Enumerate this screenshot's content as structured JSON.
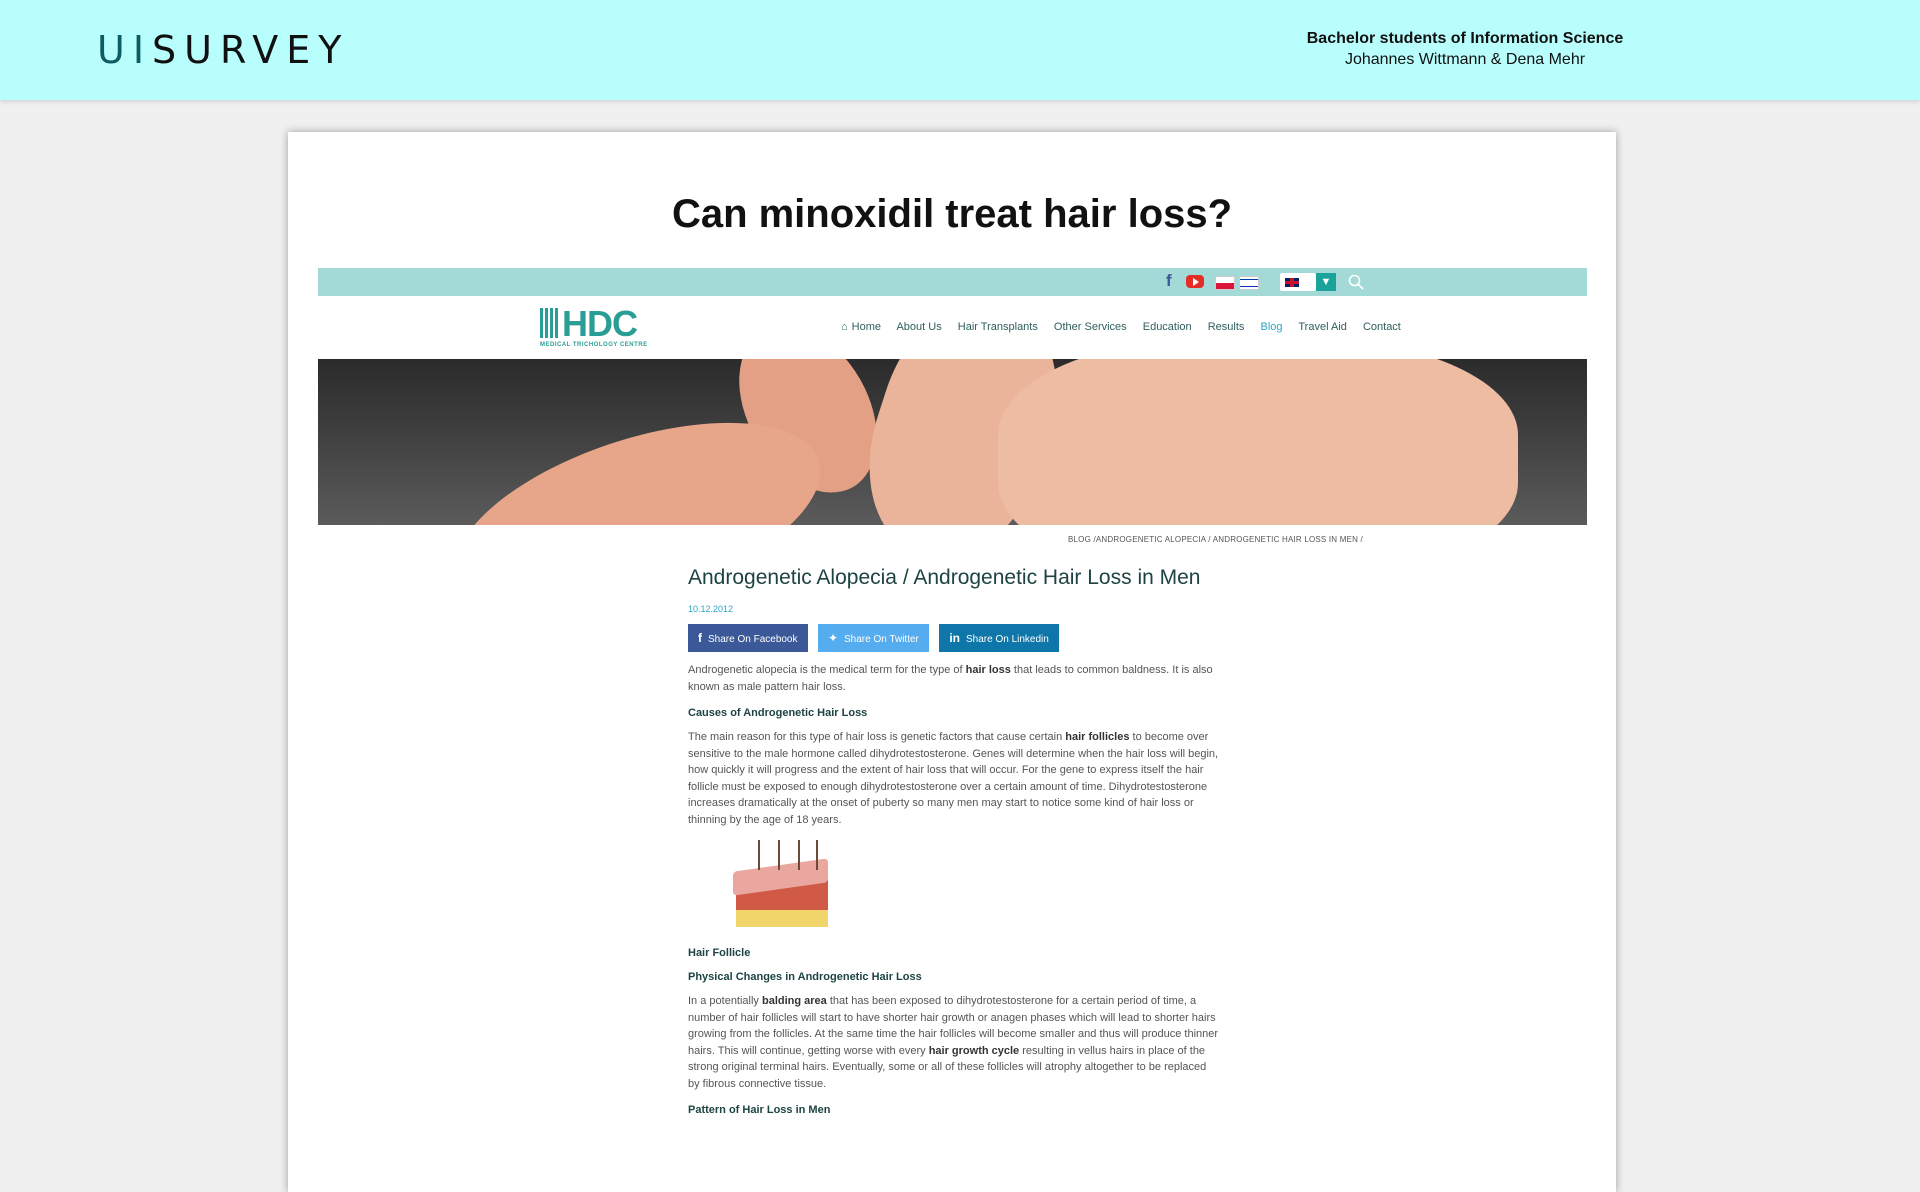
{
  "header": {
    "logo_ui": "UI",
    "logo_survey": "SURVEY",
    "credit_line1": "Bachelor students of Information Science",
    "credit_line2": "Johannes Wittmann & Dena Mehr"
  },
  "question": "Can minoxidil treat hair loss?",
  "site": {
    "brand": "HDC",
    "brand_sub": "MEDICAL TRICHOLOGY CENTRE",
    "menu": [
      "Home",
      "About Us",
      "Hair Transplants",
      "Other Services",
      "Education",
      "Results",
      "Blog",
      "Travel Aid",
      "Contact"
    ],
    "active_menu": "Blog",
    "breadcrumb": "BLOG /ANDROGENETIC ALOPECIA / ANDROGENETIC HAIR LOSS IN MEN /"
  },
  "article": {
    "title": "Androgenetic Alopecia / Androgenetic Hair Loss in Men",
    "date": "10.12.2012",
    "share_facebook": "Share On Facebook",
    "share_twitter": "Share On Twitter",
    "share_linkedin": "Share On Linkedin",
    "intro_a": "Androgenetic alopecia is the medical term for the type of ",
    "intro_b": "hair loss",
    "intro_c": " that leads to common baldness. It is also known as male pattern hair loss.",
    "h_causes": "Causes of Androgenetic Hair Loss",
    "causes_a": "The main reason for this type of hair loss is genetic factors that cause certain ",
    "causes_b": "hair follicles",
    "causes_c": " to become over sensitive to the male hormone called dihydrotestosterone. Genes will determine when the hair loss will begin, how quickly it will progress and the extent of hair loss that will occur. For the gene to express itself the hair follicle must be exposed to enough dihydrotestosterone over a certain amount of time. Dihydrotestosterone increases dramatically at the onset of puberty so many men may start to notice some kind of hair loss or thinning by the age of 18 years.",
    "caption": "Hair Follicle",
    "h_changes": "Physical Changes in Androgenetic Hair Loss",
    "changes_a": "In a potentially ",
    "changes_b": "balding area",
    "changes_c": " that has been exposed to dihydrotestosterone for a certain period of time, a number of hair follicles will start to have shorter hair growth or anagen phases which will lead to shorter hairs growing from the follicles. At the same time the hair follicles will become smaller and thus will produce thinner hairs. This will continue, getting worse with every ",
    "changes_d": "hair growth cycle",
    "changes_e": " resulting in vellus hairs in place of the strong original terminal hairs. Eventually, some or all of these follicles will atrophy altogether to be replaced by fibrous connective tissue.",
    "h_pattern": "Pattern of Hair Loss in Men"
  }
}
